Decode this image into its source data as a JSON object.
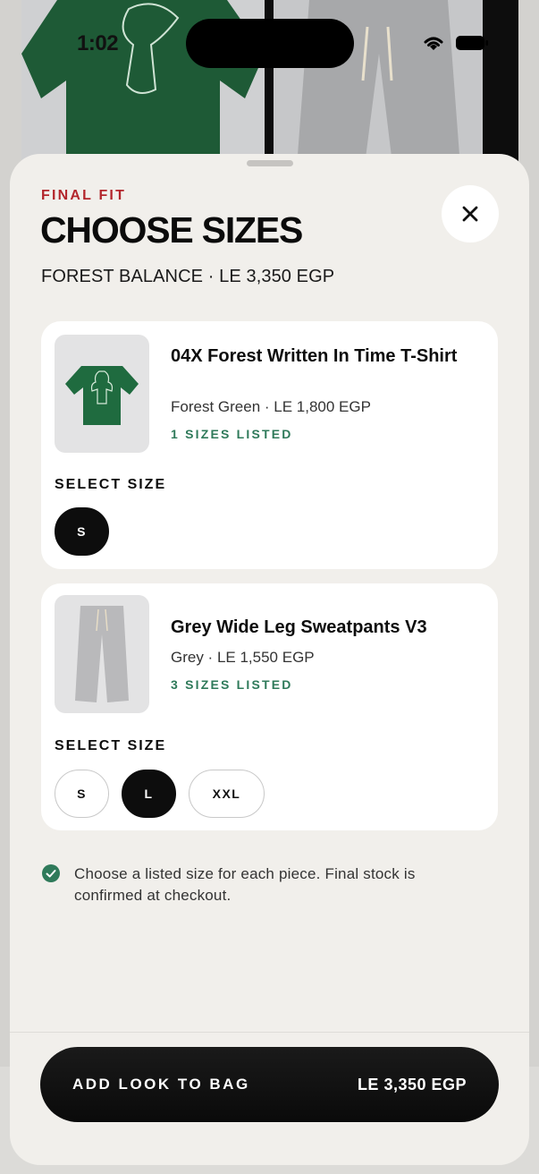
{
  "status_bar": {
    "time": "1:02"
  },
  "sheet": {
    "eyebrow": "FINAL FIT",
    "title": "CHOOSE SIZES",
    "subtitle": "FOREST BALANCE · LE 3,350 EGP",
    "close_icon": "close-icon"
  },
  "items": [
    {
      "name": "04X Forest Written In Time T-Shirt",
      "meta": "Forest Green · LE 1,800 EGP",
      "listed": "1 SIZES LISTED",
      "select_label": "SELECT SIZE",
      "sizes": [
        {
          "label": "S",
          "selected": true
        }
      ]
    },
    {
      "name": "Grey Wide Leg Sweatpants V3",
      "meta": "Grey · LE 1,550 EGP",
      "listed": "3 SIZES LISTED",
      "select_label": "SELECT SIZE",
      "sizes": [
        {
          "label": "S",
          "selected": false
        },
        {
          "label": "L",
          "selected": true
        },
        {
          "label": "XXL",
          "selected": false
        }
      ]
    }
  ],
  "note": "Choose a listed size for each piece. Final stock is confirmed at checkout.",
  "cta": {
    "label": "ADD LOOK TO BAG",
    "price": "LE 3,350 EGP"
  },
  "colors": {
    "accent_red": "#b3262c",
    "accent_green": "#2f7a5a",
    "sheet_bg": "#f1efeb",
    "selected_chip": "#0d0d0d"
  }
}
